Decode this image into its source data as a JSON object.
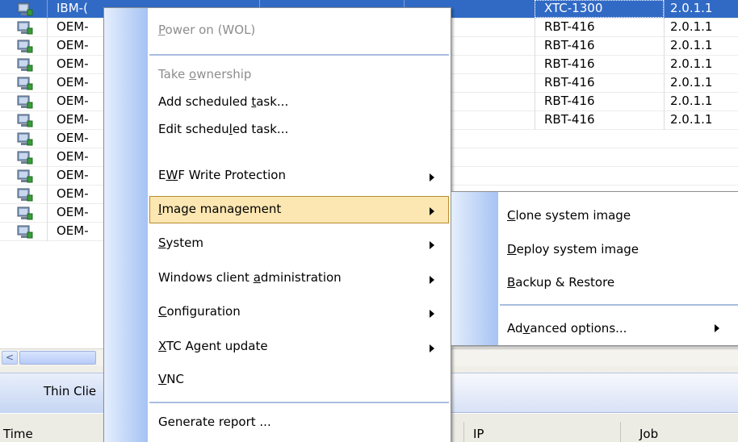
{
  "grid": {
    "rows": [
      {
        "name": "IBM-(",
        "model": "XTC-1300",
        "version": "2.0.1.1",
        "selected": true
      },
      {
        "name": "OEM-",
        "model": "RBT-416",
        "version": "2.0.1.1"
      },
      {
        "name": "OEM-",
        "model": "RBT-416",
        "version": "2.0.1.1"
      },
      {
        "name": "OEM-",
        "model": "RBT-416",
        "version": "2.0.1.1"
      },
      {
        "name": "OEM-",
        "model": "RBT-416",
        "version": "2.0.1.1"
      },
      {
        "name": "OEM-",
        "model": "RBT-416",
        "version": "2.0.1.1"
      },
      {
        "name": "OEM-",
        "model": "RBT-416",
        "version": "2.0.1.1"
      },
      {
        "name": "OEM-",
        "model": "",
        "version": ""
      },
      {
        "name": "OEM-",
        "model": "",
        "version": ""
      },
      {
        "name": "OEM-",
        "model": "",
        "version": ""
      },
      {
        "name": "OEM-",
        "model": "",
        "version": ""
      },
      {
        "name": "OEM-",
        "model": "",
        "version": ""
      },
      {
        "name": "OEM-",
        "model": "",
        "version": ""
      }
    ]
  },
  "scrollbar": {
    "left_arrow": "<"
  },
  "tabs": {
    "thin_clients": "Thin Clie"
  },
  "log_header": {
    "time": "Time",
    "ip": "IP",
    "job": "Job"
  },
  "context_menu": {
    "items": [
      {
        "pre": "",
        "u": "P",
        "post": "ower on (WOL)",
        "disabled": true,
        "submenu": false
      },
      {
        "pre": "Take ",
        "u": "o",
        "post": "wnership",
        "disabled": true,
        "submenu": false
      },
      {
        "pre": "Add scheduled ",
        "u": "t",
        "post": "ask...",
        "disabled": false,
        "submenu": false
      },
      {
        "pre": "Edit schedu",
        "u": "l",
        "post": "ed task...",
        "disabled": false,
        "submenu": false
      },
      {
        "pre": "E",
        "u": "W",
        "post": "F Write Protection",
        "disabled": false,
        "submenu": true
      },
      {
        "pre": "",
        "u": "I",
        "post": "mage management",
        "disabled": false,
        "submenu": true,
        "highlight": true
      },
      {
        "pre": "",
        "u": "S",
        "post": "ystem",
        "disabled": false,
        "submenu": true
      },
      {
        "pre": "Windows client ",
        "u": "a",
        "post": "dministration",
        "disabled": false,
        "submenu": true
      },
      {
        "pre": "",
        "u": "C",
        "post": "onfiguration",
        "disabled": false,
        "submenu": true
      },
      {
        "pre": "",
        "u": "X",
        "post": "TC Agent update",
        "disabled": false,
        "submenu": true
      },
      {
        "pre": "",
        "u": "V",
        "post": "NC",
        "disabled": false,
        "submenu": false
      },
      {
        "pre": "Generate report ...",
        "u": "",
        "post": "",
        "disabled": false,
        "submenu": false
      }
    ]
  },
  "submenu": {
    "items": [
      {
        "pre": "",
        "u": "C",
        "post": "lone system image",
        "submenu": false
      },
      {
        "pre": "",
        "u": "D",
        "post": "eploy system image",
        "submenu": false
      },
      {
        "pre": "",
        "u": "B",
        "post": "ackup & Restore",
        "submenu": false
      },
      {
        "pre": "Ad",
        "u": "v",
        "post": "anced options...",
        "submenu": true
      }
    ]
  },
  "colors": {
    "selection": "#316ac5",
    "menu_highlight": "#fce7b2",
    "menu_highlight_border": "#b98a2d",
    "menu_strip": "#a5c3f3",
    "disabled_text": "#8d8d8d"
  },
  "icons": {
    "device": "computer-monitor-icon",
    "submenu_arrow": "triangle-right-icon",
    "scroll_left": "arrow-left-icon"
  }
}
